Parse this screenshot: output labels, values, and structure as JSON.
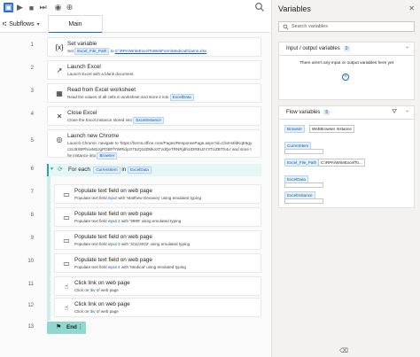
{
  "toolbar": {
    "buttons": [
      {
        "name": "save-icon",
        "glyph": "▣"
      },
      {
        "name": "run-icon",
        "glyph": "▶"
      },
      {
        "name": "stop-icon",
        "glyph": "■"
      },
      {
        "name": "step-icon",
        "glyph": "⏭"
      },
      {
        "name": "recorder-icon",
        "glyph": "◉"
      },
      {
        "name": "web-recorder-icon",
        "glyph": "⊕"
      }
    ]
  },
  "subflows": {
    "label": "Subflows",
    "tab": "Main"
  },
  "line_numbers": [
    "1",
    "2",
    "3",
    "4",
    "5",
    "6",
    "7",
    "8",
    "9",
    "10",
    "11",
    "12",
    "13"
  ],
  "actions": {
    "a1": {
      "title": "Set variable",
      "pre": "Set",
      "var": "Excel_File_Path",
      "mid": "to",
      "value": "C:\\RPA\\WriteExcelToWebForm\\MedicalClaims.xlsx"
    },
    "a2": {
      "title": "Launch Excel",
      "desc": "Launch Excel with a blank document"
    },
    "a3": {
      "title": "Read from Excel worksheet",
      "desc": "Read the values of all cells in worksheet and store it into",
      "var": "ExcelData"
    },
    "a4": {
      "title": "Close Excel",
      "desc": "Close the Excel instance stored into",
      "var": "ExcelInstance"
    },
    "a5": {
      "title": "Launch new Chrome",
      "desc": "Launch Chrome, navigate to 'https://forms.office.com/Pages/ResponsePage.aspx?id=Cb4H4fdKqE6gyc2Lt8SBPhovM2JgPDBFfYWRldy2I7tUQzdZMkozTVdQeTRNRjdNUDRBUzY3TUZBTS4u' and store the instance into",
      "var": "Browser"
    },
    "foreach": {
      "label": "For each",
      "var": "CurrentItem",
      "in": "in",
      "list": "ExcelData"
    },
    "a7": {
      "title": "Populate text field on web page",
      "pre": "Populate text field",
      "field": "input",
      "post": "with 'Matthew Devaney' using emulated typing"
    },
    "a8": {
      "title": "Populate text field on web page",
      "pre": "Populate text field",
      "field": "input 2",
      "post": "with '9999' using emulated typing"
    },
    "a9": {
      "title": "Populate text field on web page",
      "pre": "Populate text field",
      "field": "input 3",
      "post": "with '3/11/2022' using emulated typing"
    },
    "a10": {
      "title": "Populate text field on web page",
      "pre": "Populate text field",
      "field": "input 4",
      "post": "with 'Medical' using emulated typing"
    },
    "a11": {
      "title": "Click link on web page",
      "pre": "Click on",
      "target": "div",
      "post": "of web page"
    },
    "a12": {
      "title": "Click link on web page",
      "pre": "Click on",
      "target": "div",
      "post": "of web page"
    },
    "end": {
      "label": "End"
    }
  },
  "variables": {
    "title": "Variables",
    "search_placeholder": "Search variables",
    "io": {
      "title": "Input / output variables",
      "count": "0",
      "empty": "There aren't any input or output variables here yet"
    },
    "flow": {
      "title": "Flow variables",
      "count": "5",
      "items": [
        {
          "name": "Browser",
          "value": "WebBrowser Instance"
        },
        {
          "name": "CurrentItem",
          "value": ""
        },
        {
          "name": "Excel_File_Path",
          "value": "C:\\RPA\\WriteExcelTo..."
        },
        {
          "name": "ExcelData",
          "value": ""
        },
        {
          "name": "ExcelInstance",
          "value": ""
        }
      ]
    }
  },
  "colors": {
    "accent": "#0f6cbd",
    "loop": "#21a8a0",
    "end": "#8fd7cf"
  }
}
